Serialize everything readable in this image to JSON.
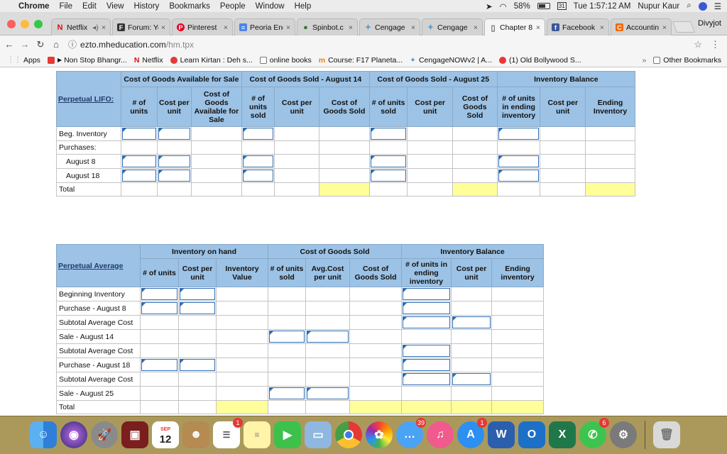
{
  "menubar": {
    "app": "Chrome",
    "items": [
      "File",
      "Edit",
      "View",
      "History",
      "Bookmarks",
      "People",
      "Window",
      "Help"
    ],
    "battery": "58%",
    "clock": "Tue 1:57:12 AM",
    "user": "Nupur Kaur"
  },
  "tabs": [
    {
      "title": "Netflix",
      "color": "#e50914",
      "glyph": "N"
    },
    {
      "title": "Forum: Yo",
      "color": "#333333",
      "glyph": "F"
    },
    {
      "title": "Pinterest",
      "color": "#e60023",
      "glyph": "P"
    },
    {
      "title": "Peoria Eng",
      "color": "#4a86e8",
      "glyph": "≡"
    },
    {
      "title": "Spinbot.c",
      "color": "#2e7d32",
      "glyph": "●"
    },
    {
      "title": "Cengage",
      "color": "#5aa0d0",
      "glyph": "✦"
    },
    {
      "title": "Cengage",
      "color": "#5aa0d0",
      "glyph": "✦"
    },
    {
      "title": "Chapter 8",
      "color": "#9e9e9e",
      "glyph": "▯"
    },
    {
      "title": "Facebook",
      "color": "#3b5998",
      "glyph": "f"
    },
    {
      "title": "Accountin",
      "color": "#f06a00",
      "glyph": "C"
    }
  ],
  "profile_name": "Divyjot",
  "address": {
    "host": "ezto.mheducation.com",
    "path": "/hm.tpx"
  },
  "bookmarks": [
    {
      "label": "Apps",
      "color": "#4caf50"
    },
    {
      "label": "Non Stop Bhangr...",
      "color": "#e53935"
    },
    {
      "label": "Netflix",
      "color": "#e50914"
    },
    {
      "label": "Learn Kirtan : Deh s...",
      "color": "#e53935"
    },
    {
      "label": "online books",
      "color": "#9e9e9e"
    },
    {
      "label": "Course: F17 Planeta...",
      "color": "#f57c00"
    },
    {
      "label": "CengageNOWv2 | A...",
      "color": "#5aa0d0"
    },
    {
      "label": "(1) Old Bollywood S...",
      "color": "#e53935"
    }
  ],
  "other_bookmarks": "Other Bookmarks",
  "table1": {
    "title": "Perpetual LIFO:",
    "groups": [
      "Cost of Goods Available for Sale",
      "Cost of Goods Sold - August 14",
      "Cost of Goods Sold - August 25",
      "Inventory Balance"
    ],
    "cols": [
      "# of units",
      "Cost per unit",
      "Cost of Goods Available for Sale",
      "# of units sold",
      "Cost per unit",
      "Cost of Goods Sold",
      "# of units sold",
      "Cost per unit",
      "Cost of Goods Sold",
      "# of units in ending inventory",
      "Cost per unit",
      "Ending Inventory"
    ],
    "rows": [
      "Beg. Inventory",
      "Purchases:",
      "August 8",
      "August 18",
      "Total"
    ]
  },
  "table2": {
    "title": "Perpetual Average",
    "groups": [
      "Inventory on hand",
      "Cost of Goods Sold",
      "Inventory Balance"
    ],
    "cols": [
      "# of units",
      "Cost per unit",
      "Inventory Value",
      "# of units sold",
      "Avg.Cost per unit",
      "Cost of Goods Sold",
      "# of units in ending inventory",
      "Cost per unit",
      "Ending inventory"
    ],
    "rows": [
      "Beginning Inventory",
      "Purchase - August 8",
      "Subtotal Average Cost",
      "Sale - August 14",
      "Subtotal Average Cost",
      "Purchase - August 18",
      "Subtotal Average Cost",
      "Sale - August 25",
      "Total"
    ]
  },
  "dock": {
    "calendar_month": "SEP",
    "calendar_day": "12",
    "badges": {
      "reminders": "1",
      "messages": "39",
      "appstore": "1",
      "whatsapp": "6"
    }
  }
}
